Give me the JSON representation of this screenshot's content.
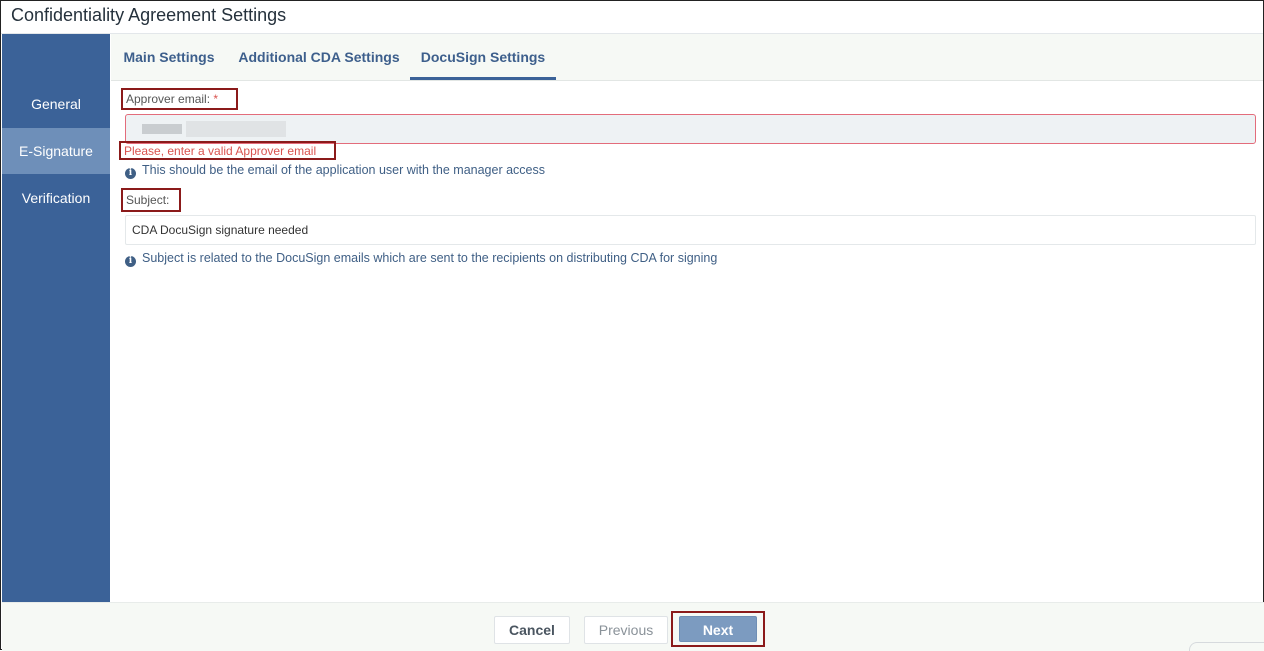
{
  "window": {
    "title": "Confidentiality Agreement Settings"
  },
  "sidebar": {
    "items": [
      {
        "label": "General",
        "active": false
      },
      {
        "label": "E-Signature",
        "active": true
      },
      {
        "label": "Verification",
        "active": false
      }
    ]
  },
  "tabs": [
    {
      "label": "Main Settings",
      "active": false
    },
    {
      "label": "Additional CDA Settings",
      "active": false
    },
    {
      "label": "DocuSign Settings",
      "active": true
    }
  ],
  "form": {
    "approver_email": {
      "label": "Approver email:",
      "required_marker": "*",
      "value": "",
      "error": "Please, enter a valid Approver email",
      "hint": "This should be the email of the application user with the manager access"
    },
    "subject": {
      "label": "Subject:",
      "required_marker": "*",
      "value": "CDA DocuSign signature needed",
      "hint": "Subject is related to the DocuSign emails which are sent to the recipients on distributing CDA for signing"
    }
  },
  "footer": {
    "cancel_label": "Cancel",
    "previous_label": "Previous",
    "next_label": "Next"
  },
  "colors": {
    "sidebar": "#3b6298",
    "sidebar_active": "#6e8fb9",
    "tab_text": "#3d5f8c",
    "error": "#d9534f",
    "highlight": "#8b1a1a",
    "next_button": "#7c9bc0"
  },
  "icons": {
    "hint": "info-circle-icon"
  }
}
